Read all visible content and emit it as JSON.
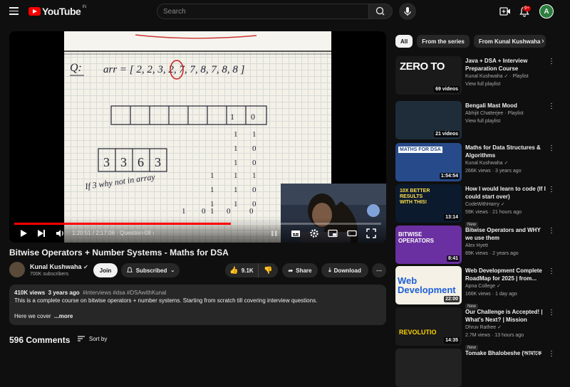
{
  "header": {
    "logo_text": "YouTube",
    "country_code": "IN",
    "search_placeholder": "Search",
    "notification_count": "9+",
    "avatar_letter": "A"
  },
  "player": {
    "time": "1:20:51 / 2:17:06",
    "chapter": "Question-08",
    "progress": 0.59,
    "whiteboard": {
      "question_label": "Q:",
      "array_text": "arr = [ 2, 2, 3, 2, 7, 7, 8, 7, 8, 8 ]",
      "box_values": [
        "3",
        "3",
        "6",
        "3"
      ],
      "note": "If 3 why not in array"
    }
  },
  "video": {
    "title": "Bitwise Operators + Number Systems - Maths for DSA",
    "channel": "Kunal Kushwaha",
    "subscribers": "700K subscribers",
    "join_label": "Join",
    "subscribed_label": "Subscribed",
    "likes": "9.1K",
    "share_label": "Share",
    "download_label": "Download"
  },
  "description": {
    "views": "410K views",
    "age": "3 years ago",
    "tags": "#interviews #dsa #DSAwithKunal",
    "line1": "This is a complete course on bitwise operators + number systems. Starting from scratch till covering interview questions.",
    "line2": "Here we cover",
    "more": "...more"
  },
  "comments": {
    "count_label": "596 Comments",
    "sort_label": "Sort by"
  },
  "chips": [
    "All",
    "From the series",
    "From Kunal Kushwaha"
  ],
  "recommendations": [
    {
      "title": "Java + DSA + Interview Preparation Course",
      "meta1": "Kunal Kushwaha ✓ · Playlist",
      "meta2": "View full playlist",
      "badge": "69 videos",
      "thumb_text": "ZERO TO",
      "color": "#1a1a1a"
    },
    {
      "title": "Bengali Mast Mood",
      "meta1": "Abhijit Chatterjee · Playlist",
      "meta2": "View full playlist",
      "badge": "21 videos",
      "thumb_text": "",
      "color": "#1f2d3a"
    },
    {
      "title": "Maths for Data Structures & Algorithms",
      "meta1": "Kunal Kushwaha ✓",
      "meta2": "266K views · 3 years ago",
      "badge": "1:54:54",
      "thumb_text": "MATHS FOR DSA",
      "color": "#274b8a"
    },
    {
      "title": "How I would learn to code (If I could start over)",
      "meta1": "CodeWithHarry ✓",
      "meta2": "59K views · 21 hours ago",
      "badge": "13:14",
      "new": "New",
      "thumb_text": "10X BETTER RESULTS WITH THIS!",
      "color": "#0c1a2e"
    },
    {
      "title": "Bitwise Operators and WHY we use them",
      "meta1": "Alex Hyett",
      "meta2": "89K views · 2 years ago",
      "badge": "8:41",
      "thumb_text": "BITWISE OPERATORS",
      "color": "#6a2fa0"
    },
    {
      "title": "Web Development Complete RoadMap for 2025 | from...",
      "meta1": "Apna College ✓",
      "meta2": "166K views · 1 day ago",
      "badge": "22:00",
      "new": "New",
      "thumb_text": "Web Development",
      "color": "#f5f1e6"
    },
    {
      "title": "Our Challenge is Accepted! | What's Next? | Mission Swaraj ...",
      "meta1": "Dhruv Rathee ✓",
      "meta2": "2.7M views · 13 hours ago",
      "badge": "14:35",
      "new": "New",
      "thumb_text": "REVOLUTIO",
      "color": "#1a1a1a"
    },
    {
      "title": "Tomake Bhalobeshe (আমাকে",
      "meta1": "",
      "meta2": "",
      "badge": "",
      "thumb_text": "",
      "color": "#222"
    }
  ]
}
